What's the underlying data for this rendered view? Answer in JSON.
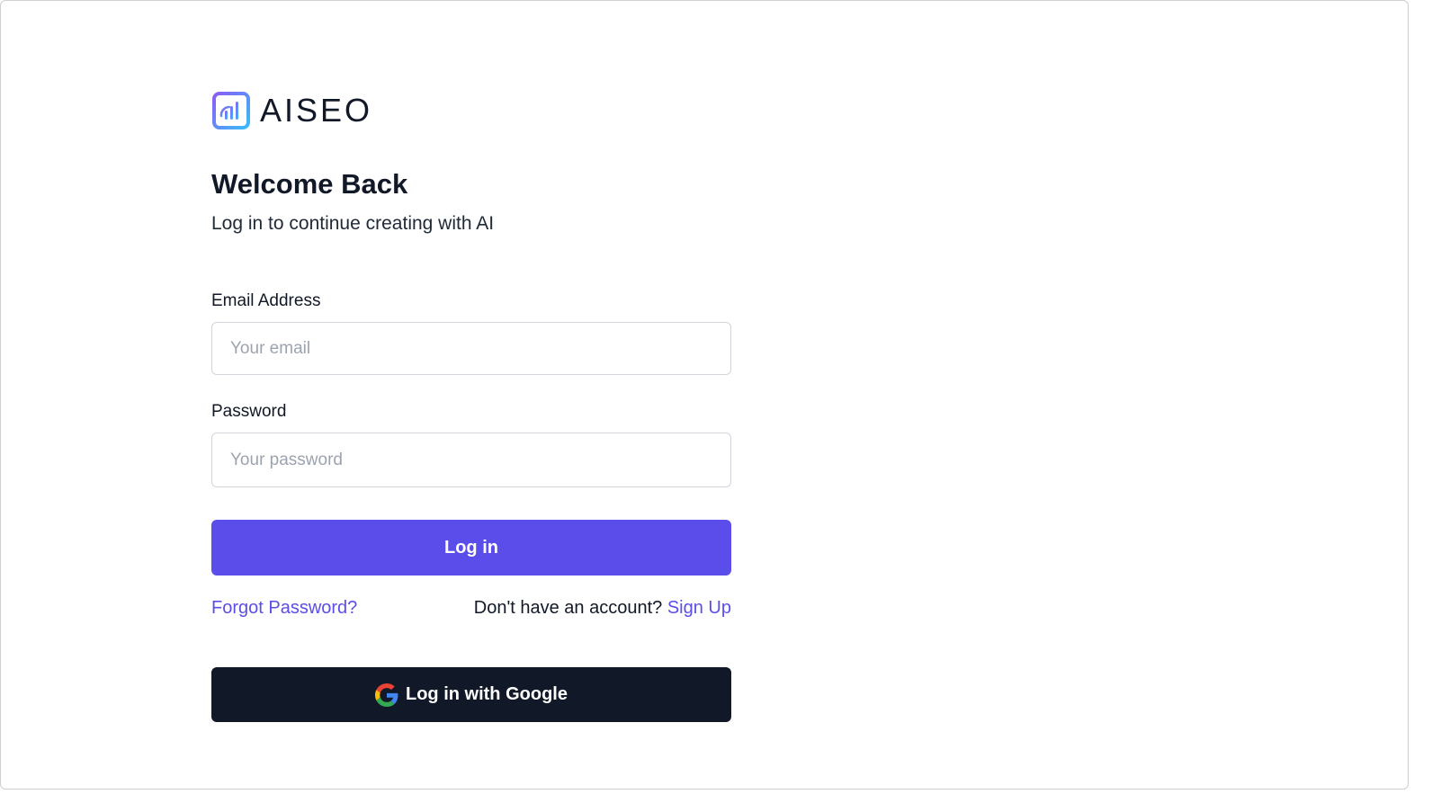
{
  "brand": {
    "name": "AISEO",
    "gradient_start": "#8b5cf6",
    "gradient_end": "#38bdf8"
  },
  "header": {
    "title": "Welcome Back",
    "subtitle": "Log in to continue creating with AI"
  },
  "form": {
    "email_label": "Email Address",
    "email_placeholder": "Your email",
    "email_value": "",
    "password_label": "Password",
    "password_placeholder": "Your password",
    "password_value": "",
    "login_label": "Log in"
  },
  "links": {
    "forgot_password": "Forgot Password?",
    "no_account_text": "Don't have an account?",
    "sign_up": "Sign Up"
  },
  "social": {
    "google_label": "Log in with Google",
    "icon": "google-icon"
  },
  "colors": {
    "accent": "#5b4de9",
    "dark_button": "#111827",
    "text": "#111827",
    "border": "#d1d5db"
  }
}
